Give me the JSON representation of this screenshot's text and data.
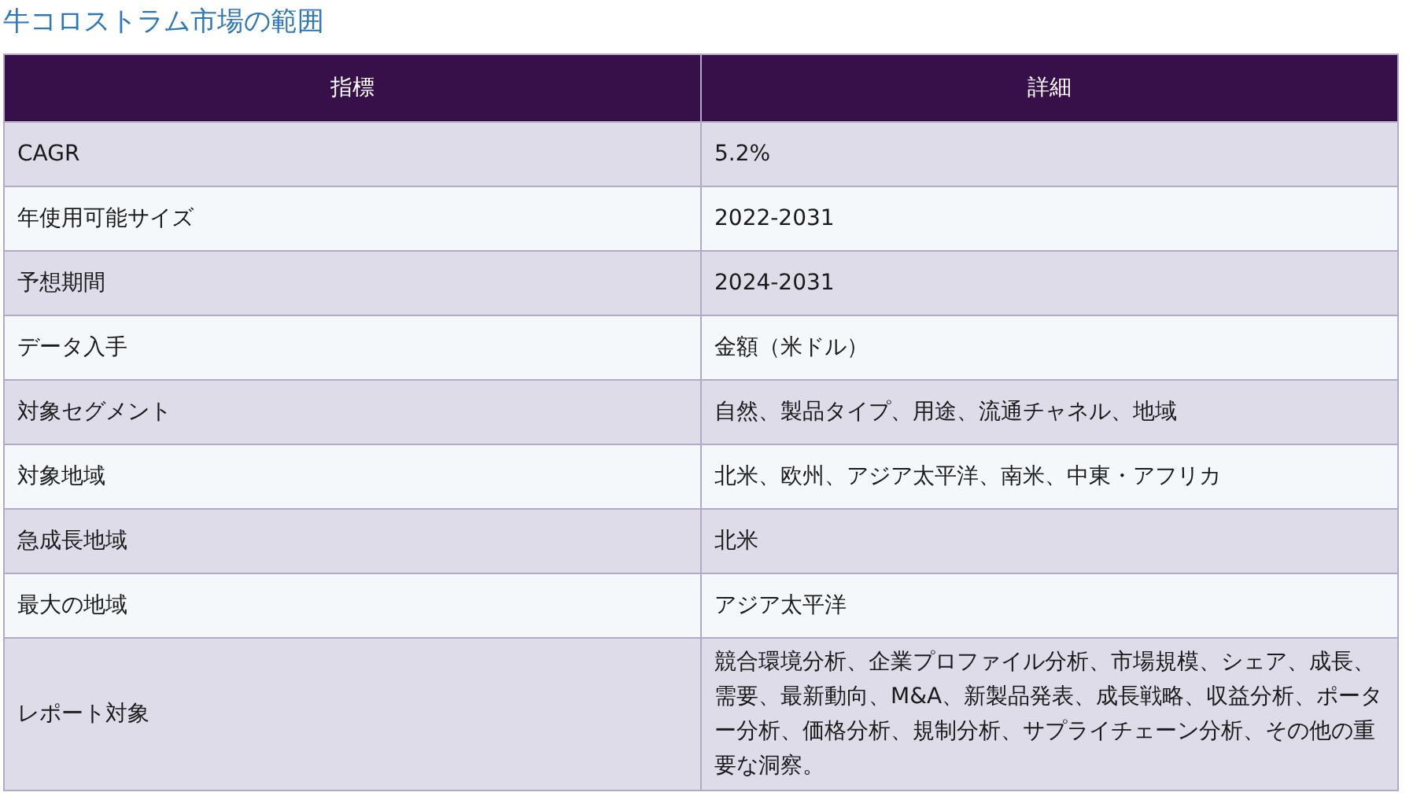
{
  "title": "牛コロストラム市場の範囲",
  "table": {
    "columns": [
      "指標",
      "詳細"
    ],
    "rows": [
      [
        "CAGR",
        "5.2%"
      ],
      [
        "年使用可能サイズ",
        "2022-2031"
      ],
      [
        "予想期間",
        "2024-2031"
      ],
      [
        "データ入手",
        "金額（米ドル）"
      ],
      [
        "対象セグメント",
        "自然、製品タイプ、用途、流通チャネル、地域"
      ],
      [
        "対象地域",
        "北米、欧州、アジア太平洋、南米、中東・アフリカ"
      ],
      [
        "急成長地域",
        "北米"
      ],
      [
        "最大の地域",
        "アジア太平洋"
      ],
      [
        "レポート対象",
        "競合環境分析、企業プロファイル分析、市場規模、シェア、成長、需要、最新動向、M&A、新製品発表、成長戦略、収益分析、ポーター分析、価格分析、規制分析、サプライチェーン分析、その他の重要な洞察。"
      ]
    ]
  }
}
